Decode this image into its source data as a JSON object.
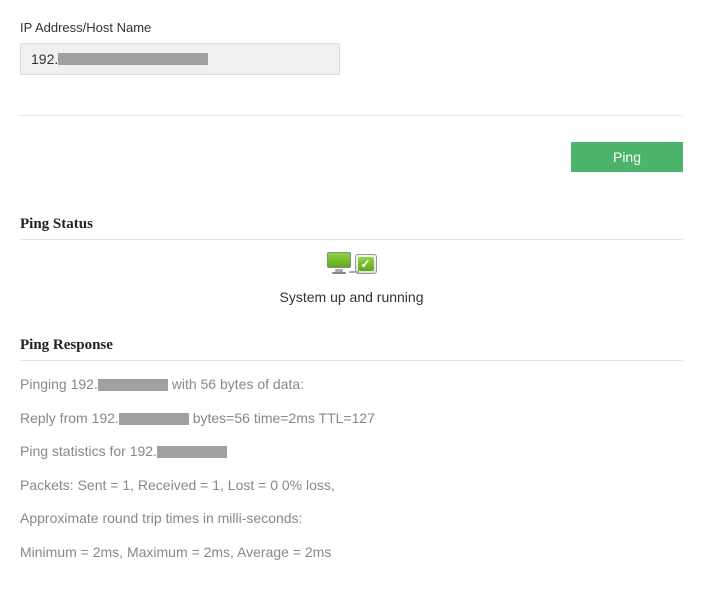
{
  "form": {
    "host_label": "IP Address/Host Name",
    "host_value_prefix": "192.",
    "ping_button": "Ping"
  },
  "status": {
    "heading": "Ping Status",
    "message": "System up and running"
  },
  "response": {
    "heading": "Ping Response",
    "lines": {
      "l1_a": "Pinging 192.",
      "l1_b": " with 56 bytes of data:",
      "l2_a": "Reply from 192.",
      "l2_b": " bytes=56 time=2ms TTL=127",
      "l3_a": "Ping statistics for 192.",
      "l3_b": "",
      "l4": "Packets: Sent = 1, Received = 1, Lost = 0 0% loss,",
      "l5": "Approximate round trip times in milli-seconds:",
      "l6": "Minimum = 2ms, Maximum = 2ms, Average = 2ms"
    }
  }
}
